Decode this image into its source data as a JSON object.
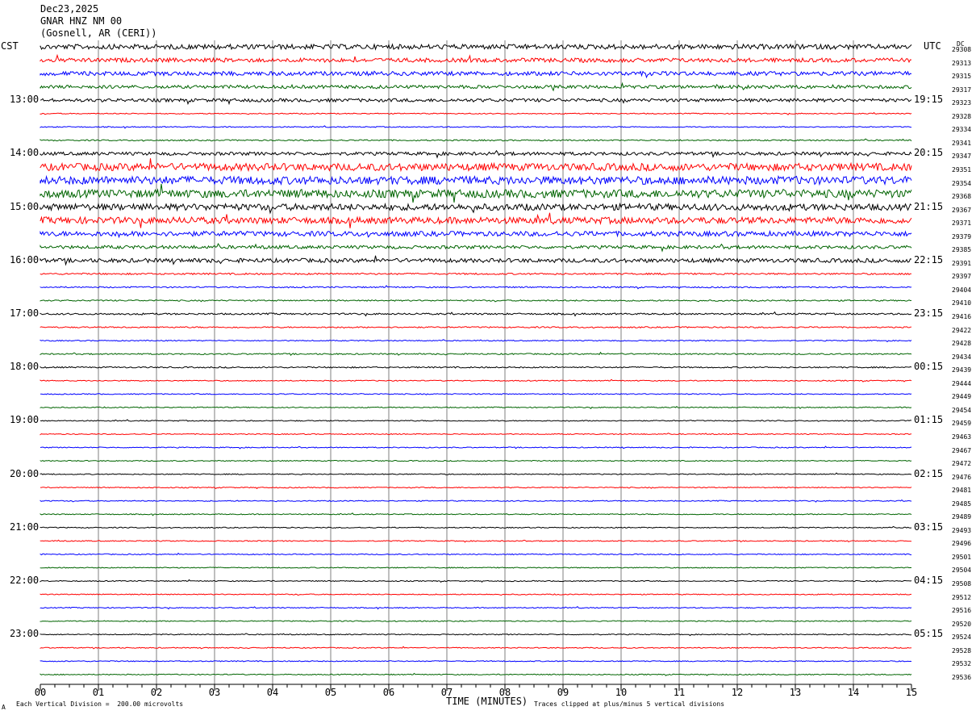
{
  "header": {
    "date": "Dec23,2025",
    "station": "GNAR HNZ NM 00",
    "location": "(Gosnell, AR (CERI))"
  },
  "left_tz_label": "CST",
  "right_tz_label": "UTC",
  "dc_label": "DC",
  "footer": {
    "scale_note": "Each Vertical Division =  200.00 microvolts",
    "xlabel": "TIME (MINUTES)",
    "clip_note": "Traces clipped at plus/minus 5 vertical divisions",
    "corner_mark": "A"
  },
  "colors": {
    "cycle": [
      "#000000",
      "#ff0000",
      "#0000ff",
      "#006400"
    ],
    "grid": "#7f7f7f"
  },
  "chart_data": {
    "type": "line",
    "title": "",
    "xlabel": "TIME (MINUTES)",
    "xlim": [
      0,
      15
    ],
    "x_ticks": [
      "00",
      "01",
      "02",
      "03",
      "04",
      "05",
      "06",
      "07",
      "08",
      "09",
      "10",
      "11",
      "12",
      "13",
      "14",
      "15"
    ],
    "rows_per_hour": 4,
    "left_hour_labels": [
      "13:00",
      "14:00",
      "15:00",
      "16:00",
      "17:00",
      "18:00",
      "19:00",
      "20:00",
      "21:00",
      "22:00",
      "23:00"
    ],
    "right_hour_labels": [
      "19:15",
      "20:15",
      "21:15",
      "22:15",
      "23:15",
      "00:15",
      "01:15",
      "02:15",
      "03:15",
      "04:15",
      "05:15"
    ],
    "dc_offsets": [
      "29308",
      "29313",
      "29315",
      "29317",
      "29323",
      "29328",
      "29334",
      "29341",
      "29347",
      "29351",
      "29354",
      "29368",
      "29367",
      "29371",
      "29379",
      "29385",
      "29391",
      "29397",
      "29404",
      "29410",
      "29416",
      "29422",
      "29428",
      "29434",
      "29439",
      "29444",
      "29449",
      "29454",
      "29459",
      "29463",
      "29467",
      "29472",
      "29476",
      "29481",
      "29485",
      "29489",
      "29493",
      "29496",
      "29501",
      "29504",
      "29508",
      "29512",
      "29516",
      "29520",
      "29524",
      "29528",
      "29532",
      "29536"
    ],
    "trace_amplitude": [
      3,
      2.5,
      2.5,
      2,
      2,
      0.6,
      0.6,
      0.8,
      2,
      4.5,
      5,
      5,
      4,
      4,
      3,
      2,
      2.5,
      1,
      0.8,
      0.8,
      1,
      0.8,
      0.6,
      0.8,
      0.8,
      0.6,
      0.6,
      0.6,
      0.6,
      0.6,
      0.6,
      0.6,
      0.6,
      0.6,
      0.6,
      0.6,
      0.6,
      0.6,
      0.6,
      0.6,
      0.6,
      0.6,
      0.6,
      0.6,
      0.6,
      0.6,
      0.6,
      0.6
    ]
  }
}
